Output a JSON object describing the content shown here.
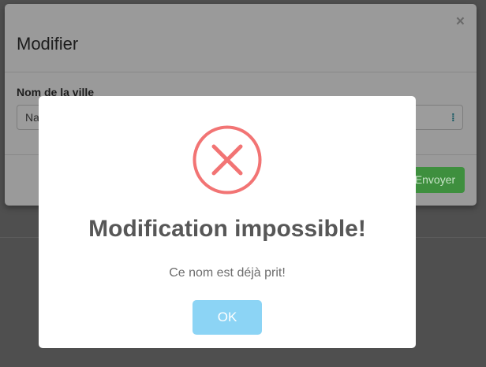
{
  "modifier_modal": {
    "title": "Modifier",
    "close_icon_glyph": "×",
    "field_label": "Nom de la ville",
    "city_input_value": "Na",
    "input_icon_name": "password-manager-icon",
    "input_icon_glyph": "⁞",
    "send_label": "Envoyer"
  },
  "alert": {
    "icon_name": "error-x-icon",
    "icon_color": "#f27474",
    "title": "Modification impossible!",
    "text": "Ce nom est déjà prit!",
    "ok_label": "OK",
    "ok_color": "#8cd4f5"
  }
}
